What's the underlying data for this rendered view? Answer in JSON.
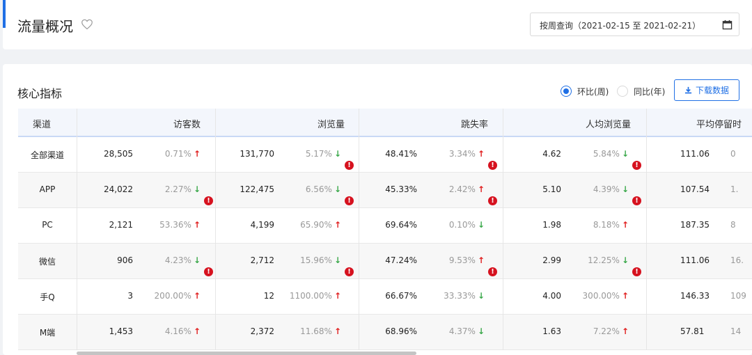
{
  "header": {
    "title": "流量概况",
    "date_label": "按周查询（2021-02-15 至 2021-02-21）"
  },
  "section": {
    "title": "核心指标",
    "radio_hb": "环比(周)",
    "radio_tb": "同比(年)",
    "download": "下载数据"
  },
  "columns": [
    "渠道",
    "访客数",
    "浏览量",
    "跳失率",
    "人均浏览量",
    "平均停留时"
  ],
  "rows": [
    {
      "channel": "全部渠道",
      "visitors": "28,505",
      "visitors_chg": "0.71%",
      "visitors_dir": "up",
      "visitors_warn": false,
      "pv": "131,770",
      "pv_chg": "5.17%",
      "pv_dir": "down",
      "pv_warn": true,
      "bounce": "48.41%",
      "bounce_chg": "3.34%",
      "bounce_dir": "up",
      "bounce_warn": true,
      "avgpv": "4.62",
      "avgpv_chg": "5.84%",
      "avgpv_dir": "down",
      "avgpv_warn": true,
      "stay": "111.06",
      "stay_chg": "0"
    },
    {
      "channel": "APP",
      "visitors": "24,022",
      "visitors_chg": "2.27%",
      "visitors_dir": "down",
      "visitors_warn": true,
      "pv": "122,475",
      "pv_chg": "6.56%",
      "pv_dir": "down",
      "pv_warn": true,
      "bounce": "45.33%",
      "bounce_chg": "2.42%",
      "bounce_dir": "up",
      "bounce_warn": true,
      "avgpv": "5.10",
      "avgpv_chg": "4.39%",
      "avgpv_dir": "down",
      "avgpv_warn": true,
      "stay": "107.54",
      "stay_chg": "1."
    },
    {
      "channel": "PC",
      "visitors": "2,121",
      "visitors_chg": "53.36%",
      "visitors_dir": "up",
      "visitors_warn": false,
      "pv": "4,199",
      "pv_chg": "65.90%",
      "pv_dir": "up",
      "pv_warn": false,
      "bounce": "69.64%",
      "bounce_chg": "0.10%",
      "bounce_dir": "down",
      "bounce_warn": false,
      "avgpv": "1.98",
      "avgpv_chg": "8.18%",
      "avgpv_dir": "up",
      "avgpv_warn": false,
      "stay": "187.35",
      "stay_chg": "8"
    },
    {
      "channel": "微信",
      "visitors": "906",
      "visitors_chg": "4.23%",
      "visitors_dir": "down",
      "visitors_warn": true,
      "pv": "2,712",
      "pv_chg": "15.96%",
      "pv_dir": "down",
      "pv_warn": true,
      "bounce": "47.24%",
      "bounce_chg": "9.53%",
      "bounce_dir": "up",
      "bounce_warn": true,
      "avgpv": "2.99",
      "avgpv_chg": "12.25%",
      "avgpv_dir": "down",
      "avgpv_warn": true,
      "stay": "111.06",
      "stay_chg": "16."
    },
    {
      "channel": "手Q",
      "visitors": "3",
      "visitors_chg": "200.00%",
      "visitors_dir": "up",
      "visitors_warn": false,
      "pv": "12",
      "pv_chg": "1100.00%",
      "pv_dir": "up",
      "pv_warn": false,
      "bounce": "66.67%",
      "bounce_chg": "33.33%",
      "bounce_dir": "down",
      "bounce_warn": false,
      "avgpv": "4.00",
      "avgpv_chg": "300.00%",
      "avgpv_dir": "up",
      "avgpv_warn": false,
      "stay": "146.33",
      "stay_chg": "109"
    },
    {
      "channel": "M端",
      "visitors": "1,453",
      "visitors_chg": "4.16%",
      "visitors_dir": "up",
      "visitors_warn": false,
      "pv": "2,372",
      "pv_chg": "11.68%",
      "pv_dir": "up",
      "pv_warn": false,
      "bounce": "68.96%",
      "bounce_chg": "4.37%",
      "bounce_dir": "down",
      "bounce_warn": false,
      "avgpv": "1.63",
      "avgpv_chg": "7.22%",
      "avgpv_dir": "up",
      "avgpv_warn": false,
      "stay": "57.81",
      "stay_chg": "14"
    }
  ],
  "colors": {
    "accent": "#1f6fe5",
    "up": "#e02020",
    "down": "#3aa84a",
    "warn": "#d6121f"
  },
  "icons": {
    "favorite": "heart-outline-icon",
    "calendar": "calendar-icon",
    "download": "download-icon",
    "up": "arrow-up-icon",
    "down": "arrow-down-icon",
    "warn": "warning-circle-icon"
  }
}
